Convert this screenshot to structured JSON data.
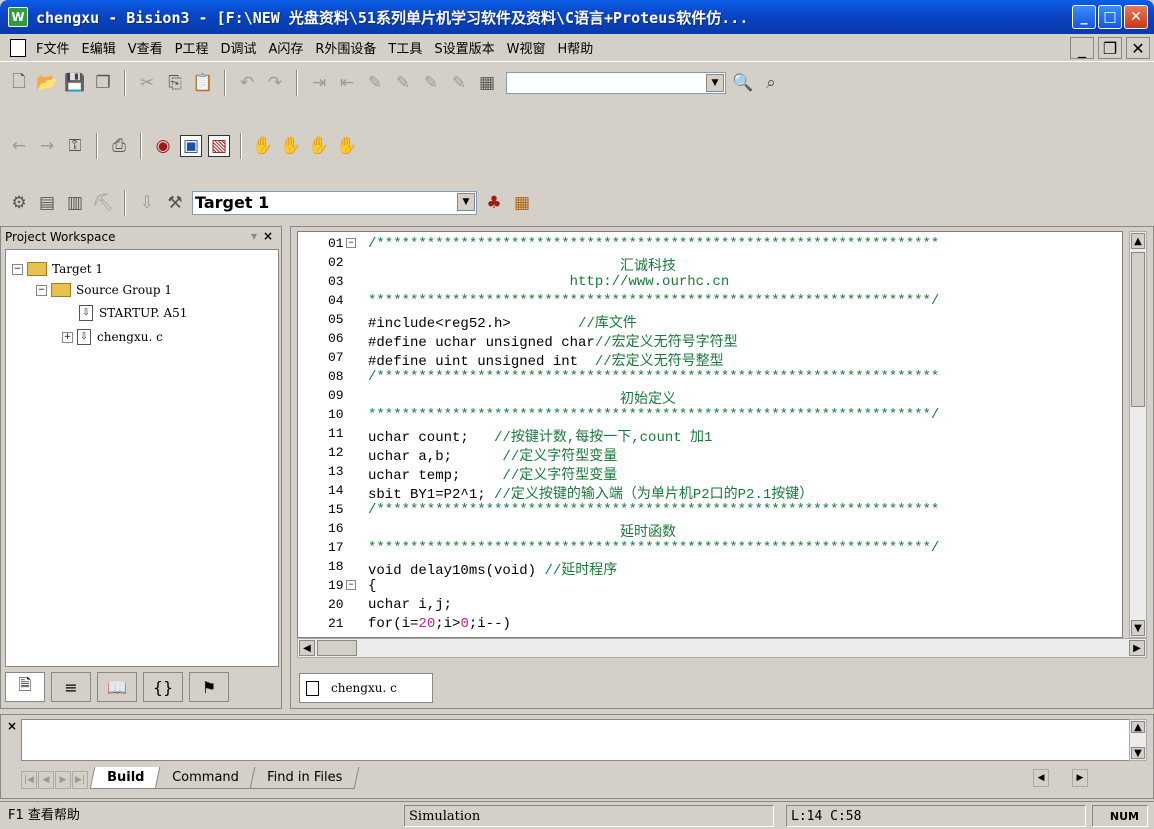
{
  "window": {
    "title": "chengxu  - Вision3 - [F:\\NEW 光盘资料\\51系列单片机学习软件及资料\\C语言+Proteus软件仿...",
    "icon_name": "uvision-app-icon"
  },
  "menu": {
    "items": [
      "F文件",
      "E编辑",
      "V查看",
      "P工程",
      "D调试",
      "A闪存",
      "R外围设备",
      "T工具",
      "S设置版本",
      "W视窗",
      "H帮助"
    ]
  },
  "toolbar": {
    "find_value": "",
    "target_value": "Target 1"
  },
  "workspace": {
    "title": "Project Workspace",
    "close_label": "×",
    "tree": [
      {
        "label": "Target 1",
        "icon": "folder-icon",
        "expander": "−"
      },
      {
        "label": "Source Group 1",
        "icon": "folder-icon",
        "expander": "−"
      },
      {
        "label": "STARTUP. A51",
        "icon": "file-icon",
        "expander": ""
      },
      {
        "label": "chengxu. c",
        "icon": "file-icon",
        "expander": "+"
      }
    ]
  },
  "editor": {
    "tab_label": "chengxu. c",
    "lines": [
      {
        "num": "01",
        "fold": "−",
        "parts": [
          {
            "t": "/*******************************************************************",
            "c": "comment"
          }
        ]
      },
      {
        "num": "02",
        "fold": "",
        "parts": [
          {
            "t": "                              汇诚科技",
            "c": "comment"
          }
        ]
      },
      {
        "num": "03",
        "fold": "",
        "parts": [
          {
            "t": "                        http://www.ourhc.cn",
            "c": "comment"
          }
        ]
      },
      {
        "num": "04",
        "fold": "",
        "parts": [
          {
            "t": "*******************************************************************/",
            "c": "comment"
          }
        ]
      },
      {
        "num": "05",
        "fold": "",
        "parts": [
          {
            "t": "#include<reg52.h>        ",
            "c": ""
          },
          {
            "t": "//库文件",
            "c": "comment"
          }
        ]
      },
      {
        "num": "06",
        "fold": "",
        "parts": [
          {
            "t": "#define uchar unsigned char",
            "c": ""
          },
          {
            "t": "//宏定义无符号字符型",
            "c": "comment"
          }
        ]
      },
      {
        "num": "07",
        "fold": "",
        "parts": [
          {
            "t": "#define uint unsigned int  ",
            "c": ""
          },
          {
            "t": "//宏定义无符号整型",
            "c": "comment"
          }
        ]
      },
      {
        "num": "08",
        "fold": "",
        "parts": [
          {
            "t": "/*******************************************************************",
            "c": "comment"
          }
        ]
      },
      {
        "num": "09",
        "fold": "",
        "parts": [
          {
            "t": "                              初始定义",
            "c": "comment"
          }
        ]
      },
      {
        "num": "10",
        "fold": "",
        "parts": [
          {
            "t": "*******************************************************************/",
            "c": "comment"
          }
        ]
      },
      {
        "num": "11",
        "fold": "",
        "parts": [
          {
            "t": "uchar count;   ",
            "c": ""
          },
          {
            "t": "//按键计数,每按一下,count 加1",
            "c": "comment"
          }
        ]
      },
      {
        "num": "12",
        "fold": "",
        "parts": [
          {
            "t": "uchar a,b;      ",
            "c": ""
          },
          {
            "t": "//定义字符型变量",
            "c": "comment"
          }
        ]
      },
      {
        "num": "13",
        "fold": "",
        "parts": [
          {
            "t": "uchar temp;     ",
            "c": ""
          },
          {
            "t": "//定义字符型变量",
            "c": "comment"
          }
        ]
      },
      {
        "num": "14",
        "fold": "",
        "parts": [
          {
            "t": "sbit BY1=P2^1; ",
            "c": ""
          },
          {
            "t": "//定义按键的输入端（为单片机P2口的P2.1按键）",
            "c": "comment"
          }
        ]
      },
      {
        "num": "15",
        "fold": "",
        "parts": [
          {
            "t": "/*******************************************************************",
            "c": "comment"
          }
        ]
      },
      {
        "num": "16",
        "fold": "",
        "parts": [
          {
            "t": "                              延时函数",
            "c": "comment"
          }
        ]
      },
      {
        "num": "17",
        "fold": "",
        "parts": [
          {
            "t": "*******************************************************************/",
            "c": "comment"
          }
        ]
      },
      {
        "num": "18",
        "fold": "",
        "parts": [
          {
            "t": "void delay10ms(void) ",
            "c": ""
          },
          {
            "t": "//延时程序",
            "c": "comment"
          }
        ]
      },
      {
        "num": "19",
        "fold": "−",
        "parts": [
          {
            "t": "{",
            "c": ""
          }
        ]
      },
      {
        "num": "20",
        "fold": "",
        "parts": [
          {
            "t": "uchar i,j;",
            "c": ""
          }
        ]
      },
      {
        "num": "21",
        "fold": "",
        "parts": [
          {
            "t": "for(i=",
            "c": ""
          },
          {
            "t": "20",
            "c": "num"
          },
          {
            "t": ";i>",
            "c": ""
          },
          {
            "t": "0",
            "c": "num"
          },
          {
            "t": ";i--)",
            "c": ""
          }
        ]
      }
    ]
  },
  "output": {
    "close_label": "×",
    "tabs": [
      "Build",
      "Command",
      "Find in Files"
    ]
  },
  "status": {
    "help": "F1 查看帮助",
    "mode": "Simulation",
    "position": "L:14 C:58",
    "num": "NUM"
  }
}
